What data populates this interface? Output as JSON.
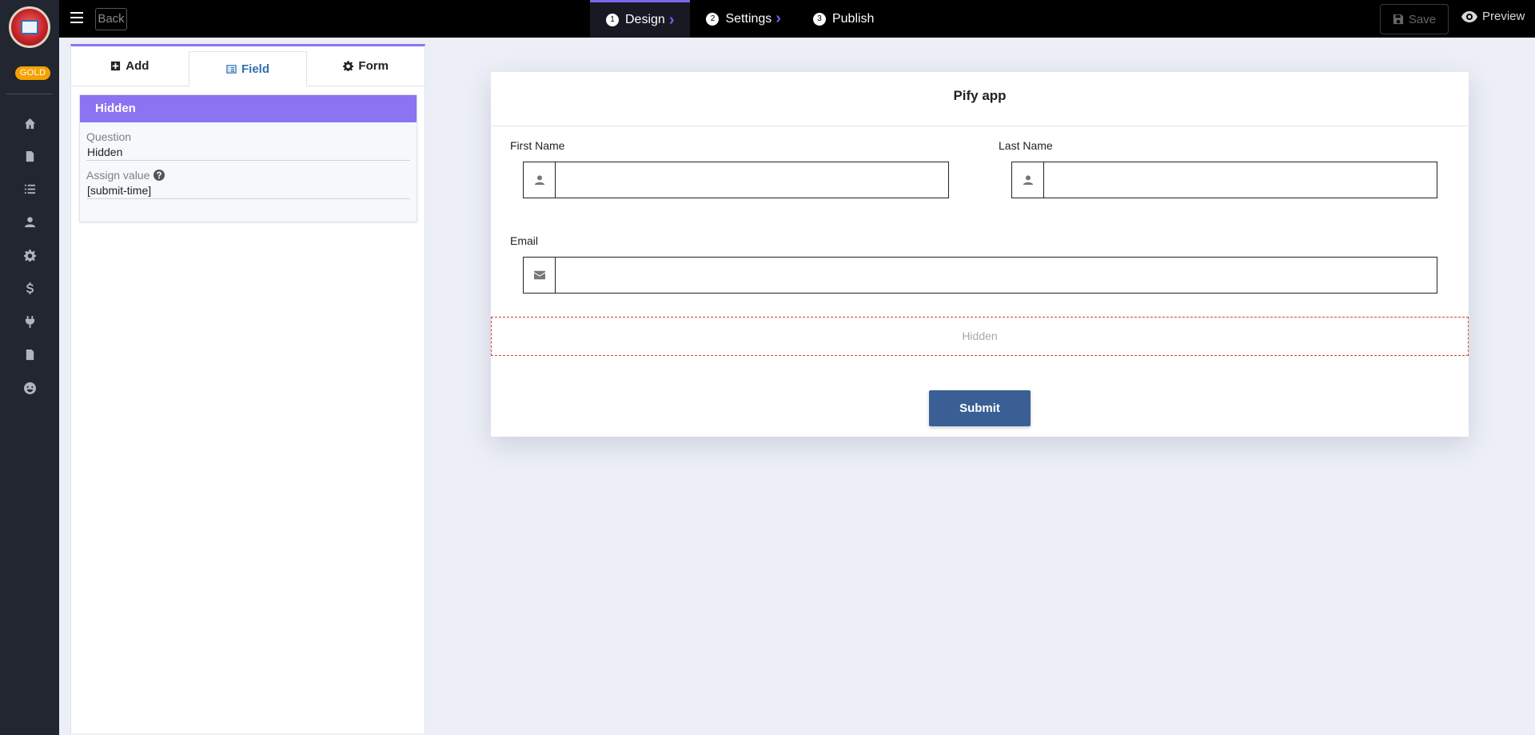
{
  "rail": {
    "plan_badge": "GOLD",
    "icons": [
      "home-icon",
      "document-icon",
      "list-icon",
      "user-icon",
      "gear-icon",
      "dollar-icon",
      "plug-icon",
      "file-icon",
      "smiley-icon"
    ]
  },
  "topbar": {
    "back_label": "Back",
    "steps": [
      {
        "num": "1",
        "label": "Design"
      },
      {
        "num": "2",
        "label": "Settings"
      },
      {
        "num": "3",
        "label": "Publish"
      }
    ],
    "save_label": "Save",
    "preview_label": "Preview"
  },
  "panel": {
    "tabs": {
      "add": "Add",
      "field": "Field",
      "form": "Form"
    },
    "field_title": "Hidden",
    "question_label": "Question",
    "question_value": "Hidden",
    "assign_label": "Assign value",
    "assign_value": "[submit-time]"
  },
  "form": {
    "title": "Pify app",
    "first_name_label": "First Name",
    "last_name_label": "Last Name",
    "email_label": "Email",
    "hidden_placeholder": "Hidden",
    "submit_label": "Submit"
  },
  "colors": {
    "accent": "#8b74f2",
    "gold": "#f5a200",
    "submit": "#3a5f95",
    "hidden_border": "#e0393e"
  }
}
